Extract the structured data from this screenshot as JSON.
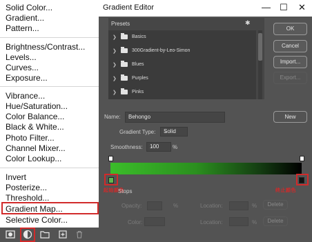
{
  "menu": {
    "items": [
      "Solid Color...",
      "Gradient...",
      "Pattern...",
      "Brightness/Contrast...",
      "Levels...",
      "Curves...",
      "Exposure...",
      "Vibrance...",
      "Hue/Saturation...",
      "Color Balance...",
      "Black & White...",
      "Photo Filter...",
      "Channel Mixer...",
      "Color Lookup...",
      "Invert",
      "Posterize...",
      "Threshold...",
      "Gradient Map...",
      "Selective Color..."
    ]
  },
  "bottom_bar": {
    "icons": [
      "mask-icon",
      "adjustment-layer-icon",
      "folder-icon",
      "new-layer-icon",
      "trash-icon"
    ]
  },
  "dialog": {
    "title": "Gradient Editor",
    "minimize": "—",
    "maximize": "☐",
    "close": "✕",
    "presets_label": "Presets",
    "gear": "✱",
    "presets": [
      "Basics",
      "300Gradient-by-Leo-Simon",
      "Blues",
      "Purples",
      "Pinks"
    ],
    "buttons": {
      "ok": "OK",
      "cancel": "Cancel",
      "import": "Import...",
      "export": "Export...",
      "new": "New"
    },
    "name_label": "Name:",
    "name_value": "Behongo",
    "gradient_type_label": "Gradient Type:",
    "gradient_type_value": "Solid",
    "smoothness_label": "Smoothness:",
    "smoothness_value": "100",
    "percent": "%",
    "stops_label": "Stops",
    "opacity_label": "Opacity:",
    "color_label": "Color:",
    "location_label": "Location:",
    "delete_label": "Delete",
    "annotation_left": "起始颜色",
    "annotation_right": "终止颜色",
    "gradient_colors": [
      "#3bbd2a",
      "#000000"
    ],
    "start_stop_color": "#5fb94f",
    "end_stop_color": "#111111"
  }
}
